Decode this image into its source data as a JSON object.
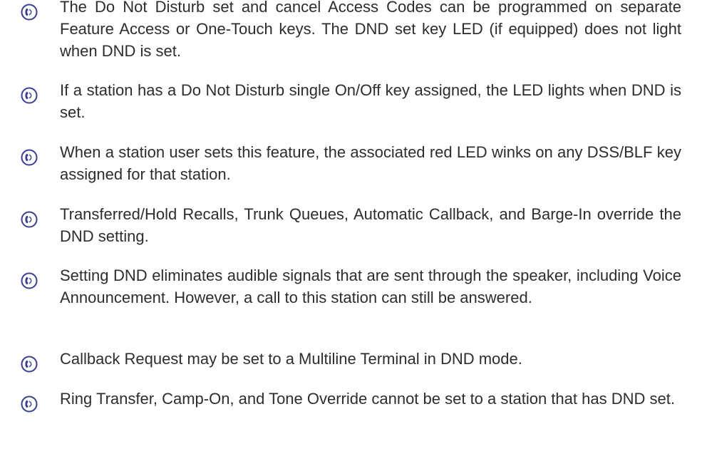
{
  "notes": [
    {
      "icon": "phone-note-icon",
      "text": "The Do Not Disturb set and cancel Access Codes can be programmed on separate Feature Access or One-Touch keys. The DND set key LED (if equipped) does not light when DND is set."
    },
    {
      "icon": "phone-note-icon",
      "text": "If a station has a Do Not Disturb single On/Off key assigned, the LED lights when DND is set."
    },
    {
      "icon": "phone-note-icon",
      "text": "When a station user sets this feature, the associated red LED winks on any DSS/BLF key assigned for that station."
    },
    {
      "icon": "phone-note-icon",
      "text": "Transferred/Hold Recalls, Trunk Queues, Automatic Callback, and Barge-In override the DND setting."
    },
    {
      "icon": "phone-note-icon",
      "text": "Setting DND eliminates audible signals that are sent through the speaker, including Voice Announcement. However, a call to this station can still be answered."
    },
    {
      "icon": "phone-note-icon",
      "text": "Callback Request may be set to a Multiline Terminal in DND mode."
    },
    {
      "icon": "phone-note-icon",
      "text": "Ring Transfer, Camp-On, and Tone Override cannot be set to a station that has DND set."
    }
  ],
  "colors": {
    "text": "#2d2d2d",
    "icon": "#3a3f8f"
  }
}
